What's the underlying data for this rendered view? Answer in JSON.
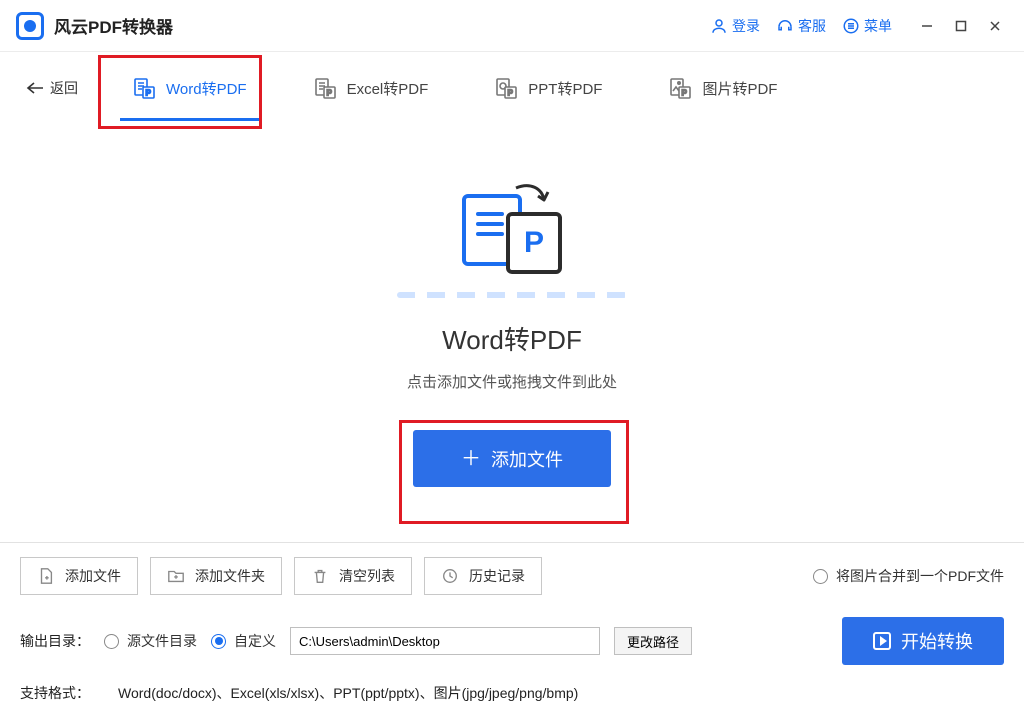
{
  "titlebar": {
    "app_name": "风云PDF转换器",
    "login": "登录",
    "support": "客服",
    "menu": "菜单"
  },
  "tabs": {
    "back": "返回",
    "items": [
      {
        "label": "Word转PDF",
        "active": true
      },
      {
        "label": "Excel转PDF",
        "active": false
      },
      {
        "label": "PPT转PDF",
        "active": false
      },
      {
        "label": "图片转PDF",
        "active": false
      }
    ]
  },
  "center": {
    "title": "Word转PDF",
    "subtitle": "点击添加文件或拖拽文件到此处",
    "add_button": "添加文件"
  },
  "bottom": {
    "buttons": {
      "add_file": "添加文件",
      "add_folder": "添加文件夹",
      "clear_list": "清空列表",
      "history": "历史记录"
    },
    "merge_option": "将图片合并到一个PDF文件",
    "output_label": "输出目录：",
    "source_dir": "源文件目录",
    "custom_dir": "自定义",
    "path_value": "C:\\Users\\admin\\Desktop",
    "change_path": "更改路径",
    "start": "开始转换",
    "formats_label": "支持格式：",
    "formats_value": "Word(doc/docx)、Excel(xls/xlsx)、PPT(ppt/pptx)、图片(jpg/jpeg/png/bmp)"
  }
}
